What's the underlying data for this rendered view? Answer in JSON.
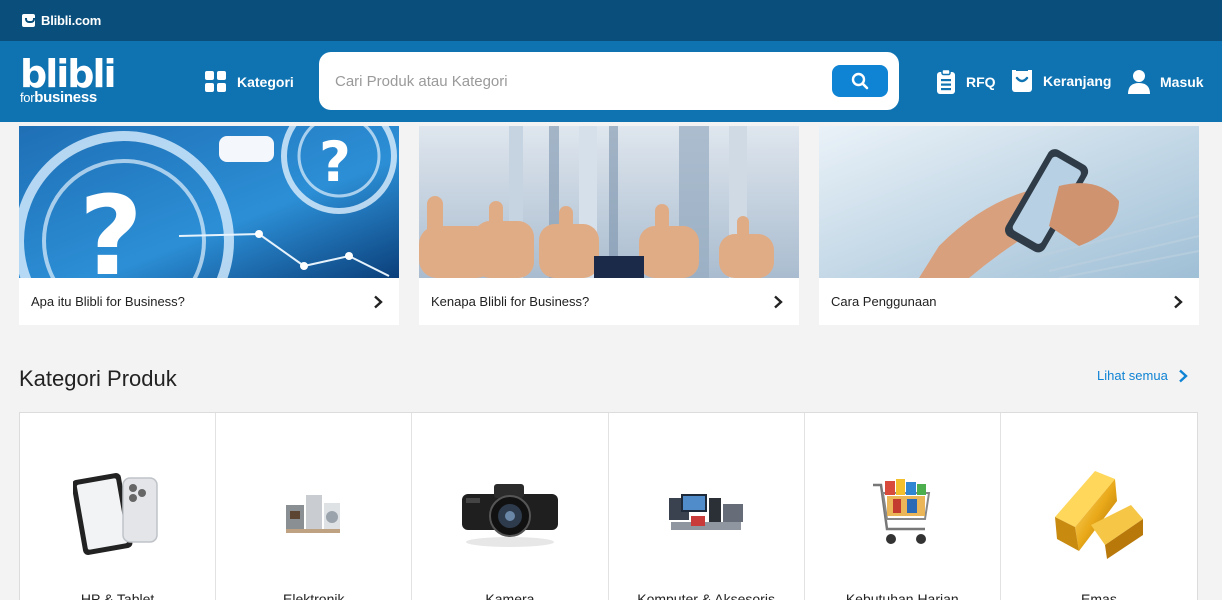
{
  "topbar": {
    "site_label": "Blibli.com"
  },
  "header": {
    "logo_text": "blibli",
    "logo_sub_for": "for",
    "logo_sub_business": "business",
    "kategori_label": "Kategori",
    "search_placeholder": "Cari Produk atau Kategori",
    "search_value": "",
    "rfq_label": "RFQ",
    "cart_label": "Keranjang",
    "login_label": "Masuk"
  },
  "promos": [
    {
      "label": "Apa itu Blibli for Business?",
      "icon": "question-marks-illustration"
    },
    {
      "label": "Kenapa Blibli for Business?",
      "icon": "thumbs-up-illustration"
    },
    {
      "label": "Cara Penggunaan",
      "icon": "phone-hands-illustration"
    }
  ],
  "categories_section": {
    "title": "Kategori Produk",
    "see_all_label": "Lihat semua",
    "items": [
      {
        "label": "HP & Tablet",
        "icon": "tablet-phone-icon"
      },
      {
        "label": "Elektronik",
        "icon": "appliances-icon"
      },
      {
        "label": "Kamera",
        "icon": "camera-icon"
      },
      {
        "label": "Komputer & Aksesoris",
        "icon": "computer-accessories-icon"
      },
      {
        "label": "Kebutuhan Harian",
        "icon": "shopping-cart-icon"
      },
      {
        "label": "Emas",
        "icon": "gold-bar-icon"
      }
    ]
  },
  "colors": {
    "header_bg": "#0f73b2",
    "topbar_bg": "#0a4f7c",
    "accent": "#0f83d4"
  }
}
